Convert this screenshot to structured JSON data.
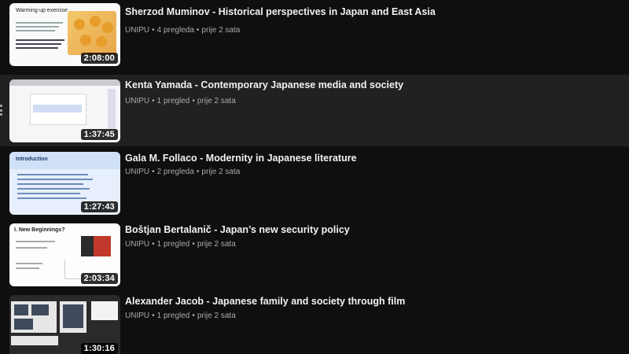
{
  "channel_name": "UNIPU",
  "meta_separator": "•",
  "videos": [
    {
      "title": "Sherzod Muminov - Historical perspectives in Japan and East Asia",
      "views": "4 pregleda",
      "posted": "prije 2 sata",
      "duration": "2:08:00",
      "thumbnail_heading": "Warming-up exercise"
    },
    {
      "title": "Kenta Yamada - Contemporary Japanese media and society",
      "views": "1 pregled",
      "posted": "prije 2 sata",
      "duration": "1:37:45"
    },
    {
      "title": "Gala M. Follaco - Modernity in Japanese literature",
      "views": "2 pregleda",
      "posted": "prije 2 sata",
      "duration": "1:27:43",
      "thumbnail_heading": "Introduction"
    },
    {
      "title": "Boštjan Bertalanič - Japan’s new security policy",
      "views": "1 pregled",
      "posted": "prije 2 sata",
      "duration": "2:03:34",
      "thumbnail_heading": "I. New Beginnings?"
    },
    {
      "title": "Alexander Jacob - Japanese family and society through film",
      "views": "1 pregled",
      "posted": "prije 2 sata",
      "duration": "1:30:16"
    }
  ],
  "colors": {
    "background": "#0f0f0f",
    "hover_row": "#212121",
    "title_text": "#f1f1f1",
    "meta_text": "#aaaaaa"
  }
}
